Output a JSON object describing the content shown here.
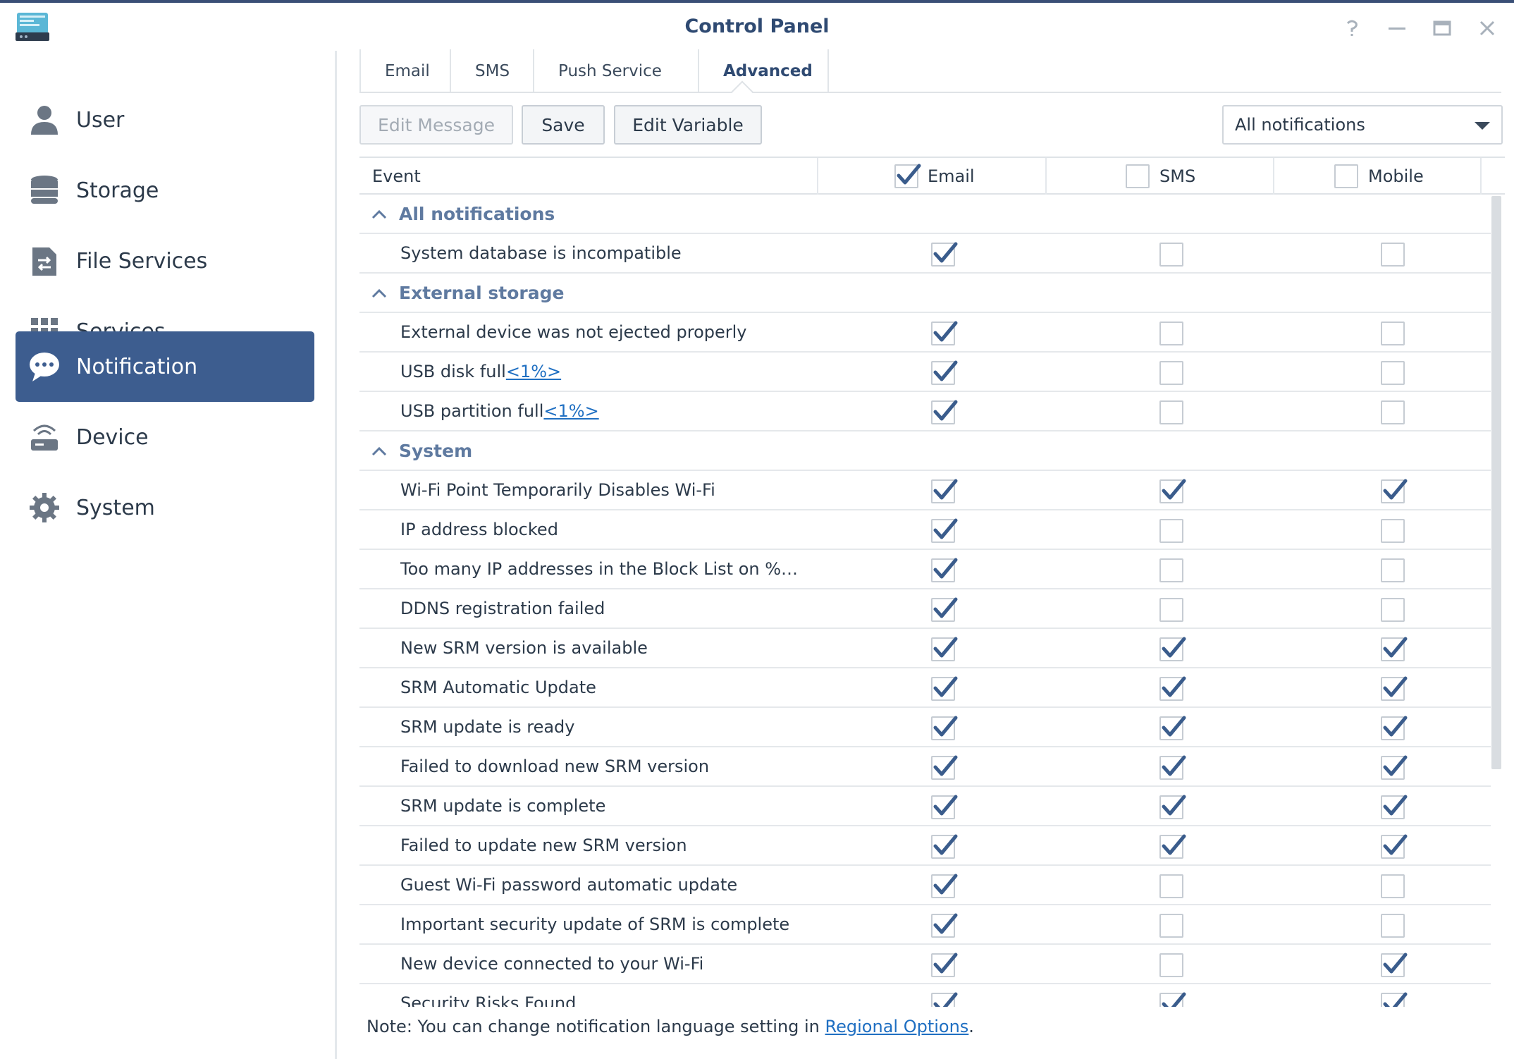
{
  "window": {
    "title": "Control Panel",
    "controls": [
      "help-icon",
      "minimize-icon",
      "maximize-icon",
      "close-icon"
    ]
  },
  "sidebar": {
    "items": [
      {
        "label": "User",
        "icon": "user-icon",
        "active": false
      },
      {
        "label": "Storage",
        "icon": "storage-icon",
        "active": false
      },
      {
        "label": "File Services",
        "icon": "file-services-icon",
        "active": false
      },
      {
        "label": "Services",
        "icon": "services-grid-icon",
        "active": false
      },
      {
        "label": "Notification",
        "icon": "notification-bubble-icon",
        "active": true
      },
      {
        "label": "Device",
        "icon": "router-icon",
        "active": false
      },
      {
        "label": "System",
        "icon": "gear-icon",
        "active": false
      }
    ]
  },
  "tabs": [
    {
      "label": "Email",
      "active": false
    },
    {
      "label": "SMS",
      "active": false
    },
    {
      "label": "Push Service",
      "active": false
    },
    {
      "label": "Advanced",
      "active": true
    }
  ],
  "toolbar": {
    "edit_message": "Edit Message",
    "save": "Save",
    "edit_variable": "Edit Variable",
    "filter_value": "All notifications"
  },
  "table": {
    "columns": {
      "event": "Event",
      "email": "Email",
      "sms": "SMS",
      "mobile": "Mobile"
    },
    "header_checks": {
      "email": true,
      "sms": false,
      "mobile": false
    },
    "groups": [
      {
        "name": "All notifications",
        "rows": [
          {
            "event": "System database is incompatible",
            "link": "",
            "email": true,
            "sms": false,
            "mobile": false
          }
        ]
      },
      {
        "name": "External storage",
        "rows": [
          {
            "event": "External device was not ejected properly",
            "link": "",
            "email": true,
            "sms": false,
            "mobile": false
          },
          {
            "event": "USB disk full",
            "link": "<1%>",
            "email": true,
            "sms": false,
            "mobile": false
          },
          {
            "event": "USB partition full",
            "link": "<1%>",
            "email": true,
            "sms": false,
            "mobile": false
          }
        ]
      },
      {
        "name": "System",
        "rows": [
          {
            "event": "Wi-Fi Point Temporarily Disables Wi-Fi",
            "link": "",
            "email": true,
            "sms": true,
            "mobile": true
          },
          {
            "event": "IP address blocked",
            "link": "",
            "email": true,
            "sms": false,
            "mobile": false
          },
          {
            "event": "Too many IP addresses in the Block List on %…",
            "link": "",
            "email": true,
            "sms": false,
            "mobile": false
          },
          {
            "event": "DDNS registration failed",
            "link": "",
            "email": true,
            "sms": false,
            "mobile": false
          },
          {
            "event": "New SRM version is available",
            "link": "",
            "email": true,
            "sms": true,
            "mobile": true
          },
          {
            "event": "SRM Automatic Update",
            "link": "",
            "email": true,
            "sms": true,
            "mobile": true
          },
          {
            "event": "SRM update is ready",
            "link": "",
            "email": true,
            "sms": true,
            "mobile": true
          },
          {
            "event": "Failed to download new SRM version",
            "link": "",
            "email": true,
            "sms": true,
            "mobile": true
          },
          {
            "event": "SRM update is complete",
            "link": "",
            "email": true,
            "sms": true,
            "mobile": true
          },
          {
            "event": "Failed to update new SRM version",
            "link": "",
            "email": true,
            "sms": true,
            "mobile": true
          },
          {
            "event": "Guest Wi-Fi password automatic update",
            "link": "",
            "email": true,
            "sms": false,
            "mobile": false
          },
          {
            "event": "Important security update of SRM is complete",
            "link": "",
            "email": true,
            "sms": false,
            "mobile": false
          },
          {
            "event": "New device connected to your Wi-Fi",
            "link": "",
            "email": true,
            "sms": false,
            "mobile": true
          },
          {
            "event": "Security Risks Found",
            "link": "",
            "email": true,
            "sms": true,
            "mobile": true
          }
        ]
      }
    ]
  },
  "note": {
    "prefix": "Note: You can change notification language setting in ",
    "link": "Regional Options",
    "suffix": "."
  },
  "colors": {
    "accent": "#3d5d8f",
    "title": "#2f4a72",
    "group": "#5f7aa0",
    "check": "#3a5c8c",
    "link": "#1f6fc2"
  }
}
